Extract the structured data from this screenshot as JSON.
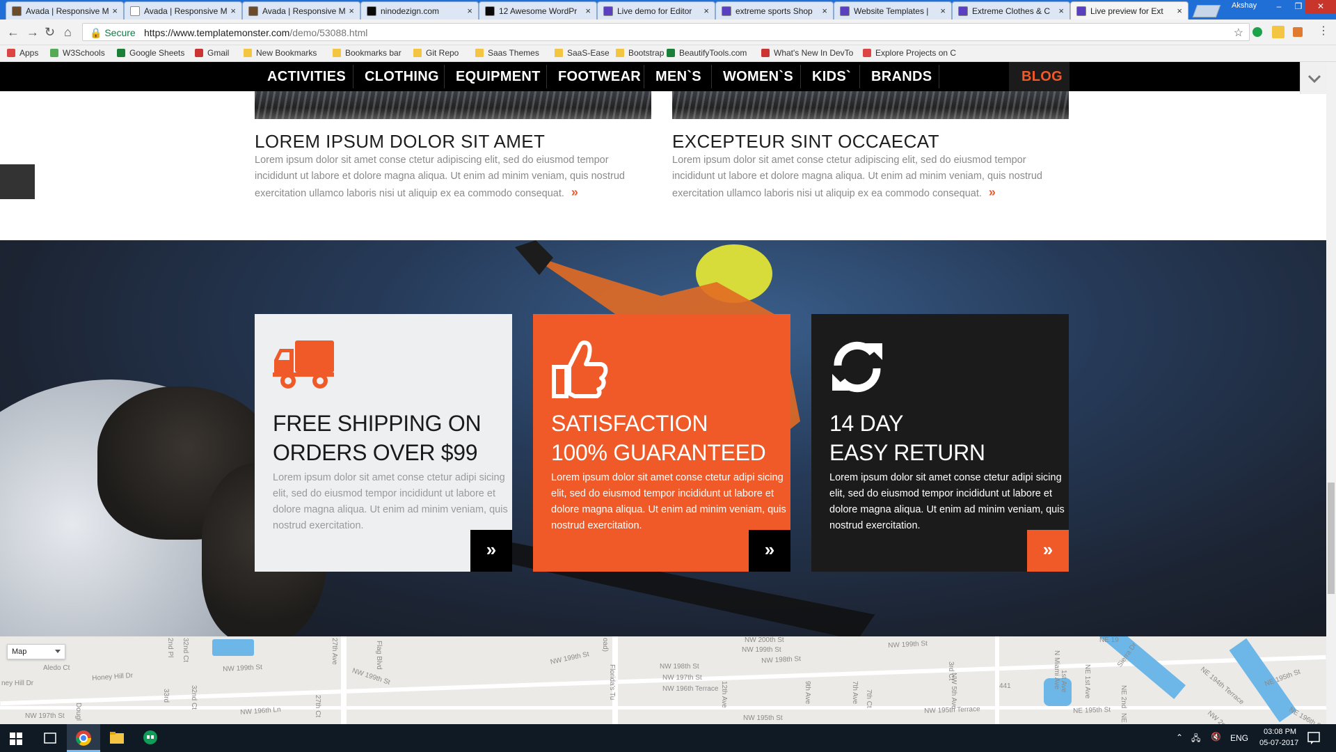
{
  "browser": {
    "tabs": [
      {
        "title": "Avada | Responsive M",
        "color": "#6b4b2a"
      },
      {
        "title": "Avada | Responsive M",
        "color": "#ffffff"
      },
      {
        "title": "Avada | Responsive M",
        "color": "#6b4b2a"
      },
      {
        "title": "ninodezign.com",
        "color": "#0a0a0a"
      },
      {
        "title": "12 Awesome WordPr",
        "color": "#0a0a0a"
      },
      {
        "title": "Live demo for Editor",
        "color": "#5a3fc0"
      },
      {
        "title": "extreme sports Shop",
        "color": "#5a3fc0"
      },
      {
        "title": "Website Templates |",
        "color": "#5a3fc0"
      },
      {
        "title": "Extreme Clothes & C",
        "color": "#5a3fc0"
      },
      {
        "title": "Live preview for Ext",
        "color": "#5a3fc0"
      }
    ],
    "close_glyph": "×",
    "user": "Akshay",
    "secure_label": "Secure",
    "url_host": "https://www.templatemonster.com",
    "url_path": "/demo/53088.html",
    "bookmarks": [
      "Apps",
      "W3Schools",
      "Google Sheets",
      "Gmail",
      "New Bookmarks",
      "Bookmarks bar",
      "Git Repo",
      "Saas Themes",
      "SaaS-Ease",
      "Bootstrap 4",
      "BeautifyTools.com",
      "What's New In DevTo",
      "Explore Projects on C"
    ]
  },
  "nav": {
    "items": [
      "ACTIVITIES",
      "CLOTHING",
      "EQUIPMENT",
      "FOOTWEAR",
      "MEN`S",
      "WOMEN`S",
      "KIDS`",
      "BRANDS"
    ],
    "blog": "BLOG",
    "accent": "#f05a28"
  },
  "posts": [
    {
      "title": "LOREM IPSUM DOLOR SIT AMET",
      "body": "Lorem ipsum dolor sit amet conse ctetur adipiscing elit, sed do eiusmod tempor incididunt ut labore et dolore magna aliqua. Ut enim ad minim veniam, quis nostrud exercitation ullamco laboris nisi ut aliquip ex ea commodo consequat.",
      "more": "»"
    },
    {
      "title": "EXCEPTEUR SINT OCCAECAT",
      "body": "Lorem ipsum dolor sit amet conse ctetur adipiscing elit, sed do eiusmod tempor incididunt ut labore et dolore magna aliqua. Ut enim ad minim veniam, quis nostrud exercitation ullamco laboris nisi ut aliquip ex ea commodo consequat.",
      "more": "»"
    }
  ],
  "features": [
    {
      "icon": "truck-icon",
      "title_line1": "FREE SHIPPING ON",
      "title_line2": "ORDERS OVER $99",
      "body": "Lorem ipsum dolor sit amet conse ctetur adipi sicing elit, sed do eiusmod tempor incididunt ut labore et dolore magna aliqua. Ut enim ad minim veniam, quis nostrud exercitation.",
      "arrow": "»"
    },
    {
      "icon": "thumbs-up-icon",
      "title_line1": "SATISFACTION",
      "title_line2": "100% GUARANTEED",
      "body": "Lorem ipsum dolor sit amet conse ctetur adipi sicing elit, sed do eiusmod tempor incididunt ut labore et dolore magna aliqua. Ut enim ad minim veniam, quis nostrud exercitation.",
      "arrow": "»"
    },
    {
      "icon": "refresh-icon",
      "title_line1": "14 DAY",
      "title_line2": "EASY RETURN",
      "body": "Lorem ipsum dolor sit amet conse ctetur adipi sicing elit, sed do eiusmod tempor incididunt ut labore et dolore magna aliqua. Ut enim ad minim veniam, quis nostrud exercitation.",
      "arrow": "»"
    }
  ],
  "map": {
    "type_selected": "Map",
    "streets": [
      "Aledo Ct",
      "Honey Hill Dr",
      "ney Hill Dr",
      "NW 197th St",
      "NW 199th St",
      "NW 196th Ln",
      "2nd Pl",
      "32nd Ct",
      "33rd",
      "32nd Ct",
      "Dougl",
      "27th Ave",
      "27th Ct",
      "NW 199th St",
      "Flag Blvd",
      "NW 199th St",
      "Florida's Tu",
      "oad)",
      "NW 198th St",
      "NW 197th St",
      "NW 196th Terrace",
      "NW 200th St",
      "NW 199th St",
      "NW 198th St",
      "12th Ave",
      "NW 195th St",
      "9th Ave",
      "7th Ave",
      "7th Ct",
      "NW 199th St",
      "NW 5th Ave",
      "3rd Ct",
      "NW 195th Terrace",
      "1st Ave",
      "NE 195th St",
      "N Miami Ave",
      "NE 1st Ave",
      "NE 2nd",
      "Sierra Dr",
      "NE 194th Terrace",
      "NE 195th St",
      "NE 196th St",
      "NE 19",
      "NE",
      "NW 2nd",
      "441"
    ]
  },
  "taskbar": {
    "language": "ENG",
    "time": "03:08 PM",
    "date": "05-07-2017"
  }
}
